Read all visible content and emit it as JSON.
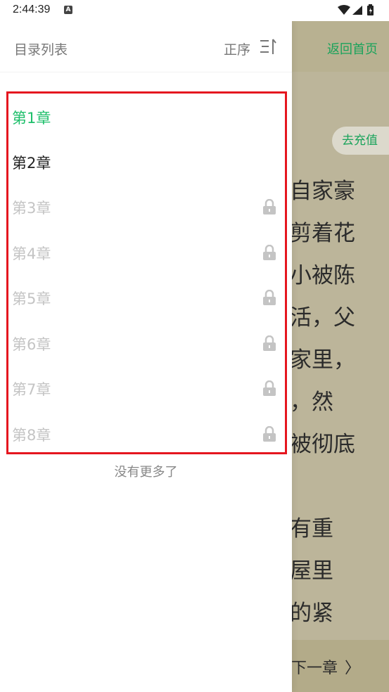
{
  "status_bar": {
    "time": "2:44:39",
    "notification_icon": "A"
  },
  "drawer": {
    "title": "目录列表",
    "order_label": "正序",
    "chapters": [
      {
        "label": "第1章",
        "state": "current"
      },
      {
        "label": "第2章",
        "state": "open"
      },
      {
        "label": "第3章",
        "state": "locked"
      },
      {
        "label": "第4章",
        "state": "locked"
      },
      {
        "label": "第5章",
        "state": "locked"
      },
      {
        "label": "第6章",
        "state": "locked"
      },
      {
        "label": "第7章",
        "state": "locked"
      },
      {
        "label": "第8章",
        "state": "locked"
      }
    ],
    "no_more": "没有更多了"
  },
  "reader": {
    "home_link": "返回首页",
    "recharge": "去充值",
    "lines": [
      "自家豪",
      "剪着花",
      "小被陈",
      "活，父",
      "家里，",
      "，然",
      "被彻底",
      "",
      "有重",
      "屋里",
      "的紧"
    ],
    "next_chapter": "下一章"
  },
  "colors": {
    "accent": "#1fbf6b",
    "highlight_border": "#e5161f",
    "reader_bg": "#bcb59a"
  }
}
